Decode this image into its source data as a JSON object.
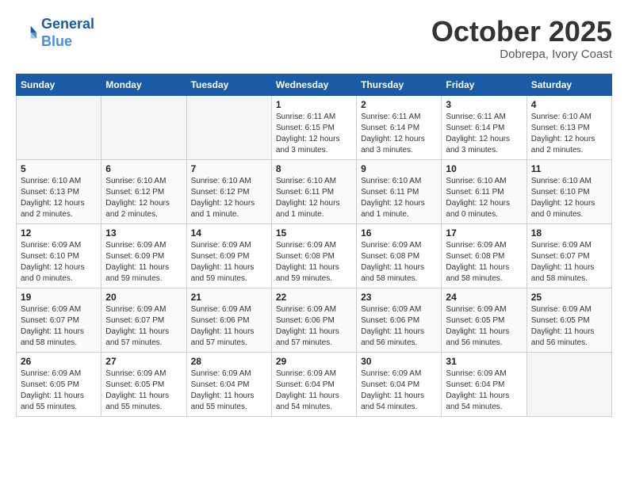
{
  "header": {
    "logo_line1": "General",
    "logo_line2": "Blue",
    "month": "October 2025",
    "location": "Dobrepa, Ivory Coast"
  },
  "weekdays": [
    "Sunday",
    "Monday",
    "Tuesday",
    "Wednesday",
    "Thursday",
    "Friday",
    "Saturday"
  ],
  "weeks": [
    [
      {
        "day": "",
        "info": ""
      },
      {
        "day": "",
        "info": ""
      },
      {
        "day": "",
        "info": ""
      },
      {
        "day": "1",
        "info": "Sunrise: 6:11 AM\nSunset: 6:15 PM\nDaylight: 12 hours and 3 minutes."
      },
      {
        "day": "2",
        "info": "Sunrise: 6:11 AM\nSunset: 6:14 PM\nDaylight: 12 hours and 3 minutes."
      },
      {
        "day": "3",
        "info": "Sunrise: 6:11 AM\nSunset: 6:14 PM\nDaylight: 12 hours and 3 minutes."
      },
      {
        "day": "4",
        "info": "Sunrise: 6:10 AM\nSunset: 6:13 PM\nDaylight: 12 hours and 2 minutes."
      }
    ],
    [
      {
        "day": "5",
        "info": "Sunrise: 6:10 AM\nSunset: 6:13 PM\nDaylight: 12 hours and 2 minutes."
      },
      {
        "day": "6",
        "info": "Sunrise: 6:10 AM\nSunset: 6:12 PM\nDaylight: 12 hours and 2 minutes."
      },
      {
        "day": "7",
        "info": "Sunrise: 6:10 AM\nSunset: 6:12 PM\nDaylight: 12 hours and 1 minute."
      },
      {
        "day": "8",
        "info": "Sunrise: 6:10 AM\nSunset: 6:11 PM\nDaylight: 12 hours and 1 minute."
      },
      {
        "day": "9",
        "info": "Sunrise: 6:10 AM\nSunset: 6:11 PM\nDaylight: 12 hours and 1 minute."
      },
      {
        "day": "10",
        "info": "Sunrise: 6:10 AM\nSunset: 6:11 PM\nDaylight: 12 hours and 0 minutes."
      },
      {
        "day": "11",
        "info": "Sunrise: 6:10 AM\nSunset: 6:10 PM\nDaylight: 12 hours and 0 minutes."
      }
    ],
    [
      {
        "day": "12",
        "info": "Sunrise: 6:09 AM\nSunset: 6:10 PM\nDaylight: 12 hours and 0 minutes."
      },
      {
        "day": "13",
        "info": "Sunrise: 6:09 AM\nSunset: 6:09 PM\nDaylight: 11 hours and 59 minutes."
      },
      {
        "day": "14",
        "info": "Sunrise: 6:09 AM\nSunset: 6:09 PM\nDaylight: 11 hours and 59 minutes."
      },
      {
        "day": "15",
        "info": "Sunrise: 6:09 AM\nSunset: 6:08 PM\nDaylight: 11 hours and 59 minutes."
      },
      {
        "day": "16",
        "info": "Sunrise: 6:09 AM\nSunset: 6:08 PM\nDaylight: 11 hours and 58 minutes."
      },
      {
        "day": "17",
        "info": "Sunrise: 6:09 AM\nSunset: 6:08 PM\nDaylight: 11 hours and 58 minutes."
      },
      {
        "day": "18",
        "info": "Sunrise: 6:09 AM\nSunset: 6:07 PM\nDaylight: 11 hours and 58 minutes."
      }
    ],
    [
      {
        "day": "19",
        "info": "Sunrise: 6:09 AM\nSunset: 6:07 PM\nDaylight: 11 hours and 58 minutes."
      },
      {
        "day": "20",
        "info": "Sunrise: 6:09 AM\nSunset: 6:07 PM\nDaylight: 11 hours and 57 minutes."
      },
      {
        "day": "21",
        "info": "Sunrise: 6:09 AM\nSunset: 6:06 PM\nDaylight: 11 hours and 57 minutes."
      },
      {
        "day": "22",
        "info": "Sunrise: 6:09 AM\nSunset: 6:06 PM\nDaylight: 11 hours and 57 minutes."
      },
      {
        "day": "23",
        "info": "Sunrise: 6:09 AM\nSunset: 6:06 PM\nDaylight: 11 hours and 56 minutes."
      },
      {
        "day": "24",
        "info": "Sunrise: 6:09 AM\nSunset: 6:05 PM\nDaylight: 11 hours and 56 minutes."
      },
      {
        "day": "25",
        "info": "Sunrise: 6:09 AM\nSunset: 6:05 PM\nDaylight: 11 hours and 56 minutes."
      }
    ],
    [
      {
        "day": "26",
        "info": "Sunrise: 6:09 AM\nSunset: 6:05 PM\nDaylight: 11 hours and 55 minutes."
      },
      {
        "day": "27",
        "info": "Sunrise: 6:09 AM\nSunset: 6:05 PM\nDaylight: 11 hours and 55 minutes."
      },
      {
        "day": "28",
        "info": "Sunrise: 6:09 AM\nSunset: 6:04 PM\nDaylight: 11 hours and 55 minutes."
      },
      {
        "day": "29",
        "info": "Sunrise: 6:09 AM\nSunset: 6:04 PM\nDaylight: 11 hours and 54 minutes."
      },
      {
        "day": "30",
        "info": "Sunrise: 6:09 AM\nSunset: 6:04 PM\nDaylight: 11 hours and 54 minutes."
      },
      {
        "day": "31",
        "info": "Sunrise: 6:09 AM\nSunset: 6:04 PM\nDaylight: 11 hours and 54 minutes."
      },
      {
        "day": "",
        "info": ""
      }
    ]
  ]
}
